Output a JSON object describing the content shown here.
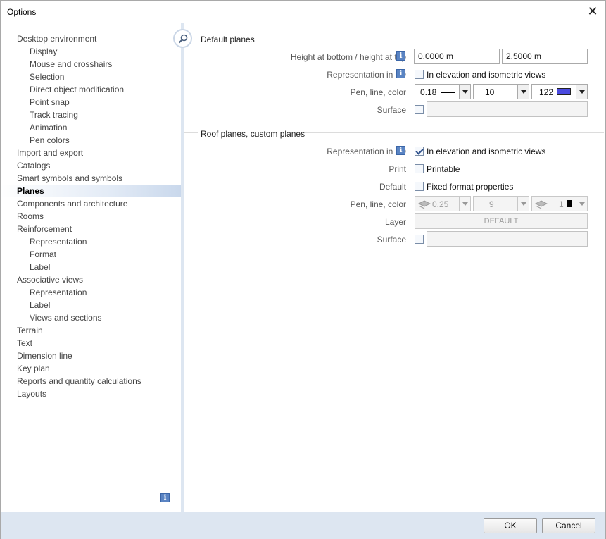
{
  "window": {
    "title": "Options"
  },
  "sidebar": {
    "items": [
      {
        "label": "Desktop environment",
        "level": 0
      },
      {
        "label": "Display",
        "level": 1
      },
      {
        "label": "Mouse and crosshairs",
        "level": 1
      },
      {
        "label": "Selection",
        "level": 1
      },
      {
        "label": "Direct object modification",
        "level": 1
      },
      {
        "label": "Point snap",
        "level": 1
      },
      {
        "label": "Track tracing",
        "level": 1
      },
      {
        "label": "Animation",
        "level": 1
      },
      {
        "label": "Pen colors",
        "level": 1
      },
      {
        "label": "Import and export",
        "level": 0
      },
      {
        "label": "Catalogs",
        "level": 0
      },
      {
        "label": "Smart symbols and symbols",
        "level": 0
      },
      {
        "label": "Planes",
        "level": 0,
        "selected": true
      },
      {
        "label": "Components and architecture",
        "level": 0
      },
      {
        "label": "Rooms",
        "level": 0
      },
      {
        "label": "Reinforcement",
        "level": 0
      },
      {
        "label": "Representation",
        "level": 1
      },
      {
        "label": "Format",
        "level": 1
      },
      {
        "label": "Label",
        "level": 1
      },
      {
        "label": "Associative views",
        "level": 0
      },
      {
        "label": "Representation",
        "level": 1
      },
      {
        "label": "Label",
        "level": 1
      },
      {
        "label": "Views and sections",
        "level": 1
      },
      {
        "label": "Terrain",
        "level": 0
      },
      {
        "label": "Text",
        "level": 0
      },
      {
        "label": "Dimension line",
        "level": 0
      },
      {
        "label": "Key plan",
        "level": 0
      },
      {
        "label": "Reports and quantity calculations",
        "level": 0
      },
      {
        "label": "Layouts",
        "level": 0
      }
    ]
  },
  "default_planes": {
    "heading": "Default planes",
    "height_label": "Height at bottom / height at top",
    "height_bottom": "0.0000 m",
    "height_top": "2.5000 m",
    "rep3d_label": "Representation in 3D",
    "rep3d_check_label": "In elevation and isometric views",
    "rep3d_checked": false,
    "pen_label": "Pen, line, color",
    "pen_value": "0.18",
    "line_value": "10",
    "color_value": "122",
    "color_swatch": "#4a4ae0",
    "surface_label": "Surface"
  },
  "roof_planes": {
    "heading": "Roof planes, custom planes",
    "rep3d_label": "Representation in 3D",
    "rep3d_check_label": "In elevation and isometric views",
    "rep3d_checked": true,
    "print_label": "Print",
    "print_check_label": "Printable",
    "default_label": "Default",
    "default_check_label": "Fixed format properties",
    "pen_label": "Pen, line, color",
    "pen_value": "0.25",
    "line_value": "9",
    "color_value": "1",
    "color_swatch": "#000000",
    "layer_label": "Layer",
    "layer_value": "DEFAULT",
    "surface_label": "Surface"
  },
  "info_glyph": "i",
  "footer": {
    "ok_label": "OK",
    "cancel_label": "Cancel"
  },
  "close_glyph": "✕"
}
